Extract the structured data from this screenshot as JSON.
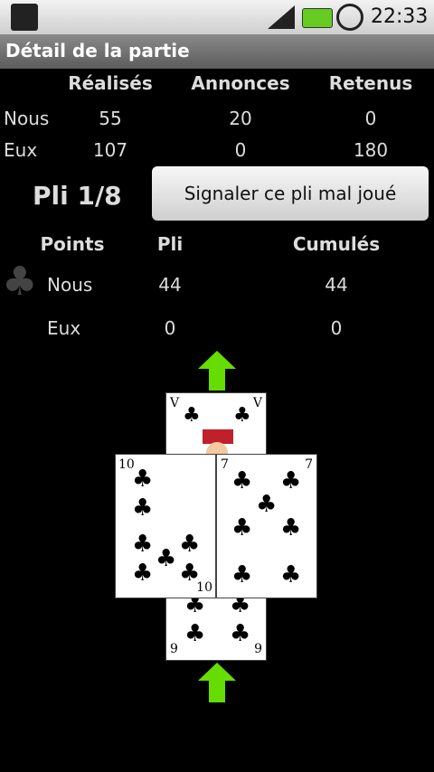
{
  "status": {
    "time": "22:33",
    "icons": [
      "usb-icon",
      "signal-icon",
      "battery-icon",
      "alarm-icon"
    ]
  },
  "title": "Détail de la partie",
  "score": {
    "headers": [
      "Réalisés",
      "Annonces",
      "Retenus"
    ],
    "rows": [
      {
        "label": "Nous",
        "values": [
          "55",
          "20",
          "0"
        ]
      },
      {
        "label": "Eux",
        "values": [
          "107",
          "0",
          "180"
        ]
      }
    ]
  },
  "pli": {
    "label": "Pli 1/8",
    "report_button": "Signaler ce pli mal joué"
  },
  "points": {
    "headers": [
      "Points",
      "Pli",
      "Cumulés"
    ],
    "trump_icon": "club-icon",
    "rows": [
      {
        "label": "Nous",
        "pli": "44",
        "cumules": "44"
      },
      {
        "label": "Eux",
        "pli": "0",
        "cumules": "0"
      }
    ]
  },
  "cards": [
    {
      "name": "card-top",
      "rank": "V"
    },
    {
      "name": "card-left",
      "rank": "10"
    },
    {
      "name": "card-right",
      "rank": "7"
    },
    {
      "name": "card-bottom",
      "rank": "9"
    }
  ],
  "colors": {
    "arrow": "#66dd00"
  }
}
